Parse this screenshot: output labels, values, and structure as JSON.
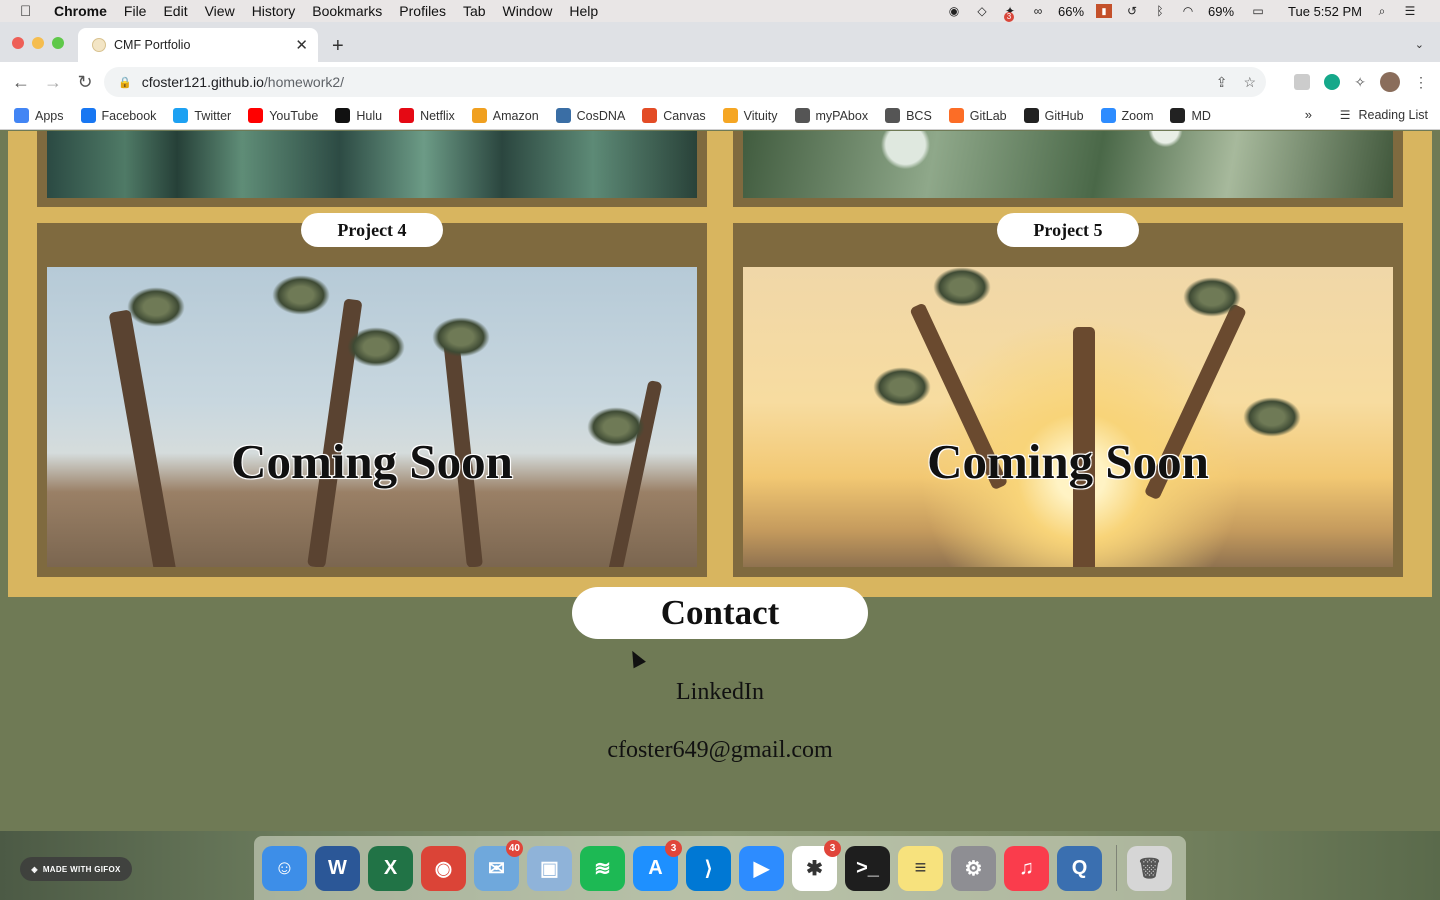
{
  "menubar": {
    "app_name": "Chrome",
    "menus": [
      "File",
      "Edit",
      "View",
      "History",
      "Bookmarks",
      "Profiles",
      "Tab",
      "Window",
      "Help"
    ],
    "battery_app_pct": "66%",
    "battery_pct": "69%",
    "clock": "Tue 5:52 PM",
    "badge_count": "3"
  },
  "tab": {
    "title": "CMF Portfolio"
  },
  "address": {
    "host": "cfoster121.github.io",
    "path": "/homework2/"
  },
  "bookmarks": {
    "items": [
      {
        "label": "Apps",
        "icon": "apps-grid-icon",
        "color": "#4285f4"
      },
      {
        "label": "Facebook",
        "icon": "facebook-icon",
        "color": "#1877f2"
      },
      {
        "label": "Twitter",
        "icon": "twitter-icon",
        "color": "#1da1f2"
      },
      {
        "label": "YouTube",
        "icon": "youtube-icon",
        "color": "#ff0000"
      },
      {
        "label": "Hulu",
        "icon": "hulu-icon",
        "color": "#111111"
      },
      {
        "label": "Netflix",
        "icon": "netflix-icon",
        "color": "#e50914"
      },
      {
        "label": "Amazon",
        "icon": "amazon-icon",
        "color": "#f0a020"
      },
      {
        "label": "CosDNA",
        "icon": "cosdna-icon",
        "color": "#3a6ea5"
      },
      {
        "label": "Canvas",
        "icon": "canvas-icon",
        "color": "#e34c26"
      },
      {
        "label": "Vituity",
        "icon": "vituity-icon",
        "color": "#f5a623"
      },
      {
        "label": "myPAbox",
        "icon": "globe-icon",
        "color": "#555555"
      },
      {
        "label": "BCS",
        "icon": "globe-icon",
        "color": "#555555"
      },
      {
        "label": "GitLab",
        "icon": "gitlab-icon",
        "color": "#fc6d26"
      },
      {
        "label": "GitHub",
        "icon": "github-icon",
        "color": "#222222"
      },
      {
        "label": "Zoom",
        "icon": "zoom-icon",
        "color": "#2d8cff"
      },
      {
        "label": "MD",
        "icon": "md-icon",
        "color": "#222222"
      }
    ],
    "more": "»",
    "reading_list": "Reading List"
  },
  "projects": [
    {
      "title": "Project 4",
      "overlay": "Coming Soon"
    },
    {
      "title": "Project 5",
      "overlay": "Coming Soon"
    }
  ],
  "contact": {
    "heading": "Contact",
    "linkedin": "LinkedIn",
    "email": "cfoster649@gmail.com"
  },
  "gifox": {
    "label": "MADE WITH GIFOX"
  },
  "dock": {
    "apps": [
      {
        "name": "finder-icon",
        "color": "#3d8ee8",
        "glyph": "☺"
      },
      {
        "name": "word-icon",
        "color": "#2b5797",
        "glyph": "W"
      },
      {
        "name": "excel-icon",
        "color": "#217346",
        "glyph": "X"
      },
      {
        "name": "chrome-icon",
        "color": "#db4437",
        "glyph": "◉"
      },
      {
        "name": "mail-icon",
        "color": "#6fa8dc",
        "glyph": "✉",
        "badge": "40"
      },
      {
        "name": "preview-icon",
        "color": "#8fb3d9",
        "glyph": "▣"
      },
      {
        "name": "spotify-icon",
        "color": "#1db954",
        "glyph": "≋"
      },
      {
        "name": "app-store-icon",
        "color": "#1e90ff",
        "glyph": "A",
        "badge": "3"
      },
      {
        "name": "vscode-icon",
        "color": "#0078d4",
        "glyph": "⟩"
      },
      {
        "name": "zoom-icon",
        "color": "#2d8cff",
        "glyph": "▶"
      },
      {
        "name": "slack-icon",
        "color": "#ffffff",
        "glyph": "✱",
        "badge": "3"
      },
      {
        "name": "terminal-icon",
        "color": "#1e1e1e",
        "glyph": ">_"
      },
      {
        "name": "notes-icon",
        "color": "#f7e27d",
        "glyph": "≡"
      },
      {
        "name": "system-preferences-icon",
        "color": "#8e8e93",
        "glyph": "⚙"
      },
      {
        "name": "music-icon",
        "color": "#fa3c4c",
        "glyph": "♫"
      },
      {
        "name": "quicktime-icon",
        "color": "#3a6fb0",
        "glyph": "Q"
      }
    ],
    "trash": {
      "name": "trash-icon",
      "color": "#d6d6d6",
      "glyph": "🗑"
    }
  }
}
